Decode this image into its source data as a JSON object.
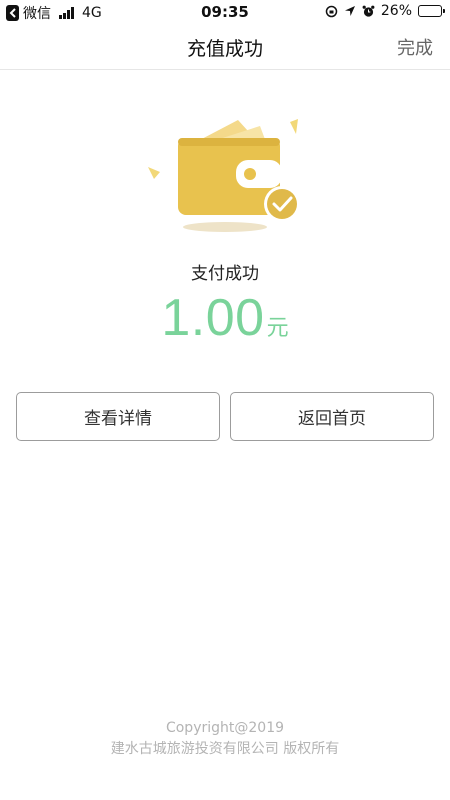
{
  "status_bar": {
    "carrier": "微信",
    "network": "4G",
    "time": "09:35",
    "battery": "26%",
    "battery_level": 0.26
  },
  "nav": {
    "title": "充值成功",
    "done_label": "完成"
  },
  "result": {
    "status_text": "支付成功",
    "amount": "1.00",
    "currency": "元"
  },
  "actions": {
    "detail_label": "查看详情",
    "home_label": "返回首页"
  },
  "footer": {
    "copyright": "Copyright@2019",
    "company": "建水古城旅游投资有限公司 版权所有"
  },
  "colors": {
    "accent_green": "#7ad39a",
    "wallet_gold": "#e8c24e"
  }
}
